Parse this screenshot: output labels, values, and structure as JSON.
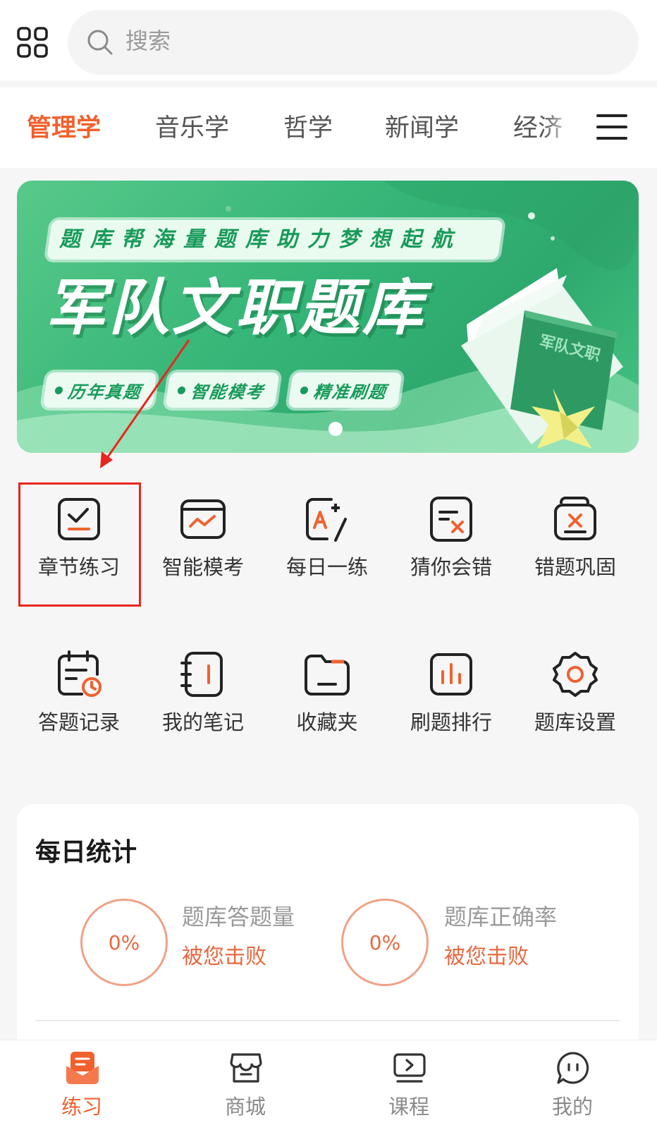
{
  "search": {
    "placeholder": "搜索"
  },
  "tabs": [
    {
      "label": "管理学",
      "active": true
    },
    {
      "label": "音乐学",
      "active": false
    },
    {
      "label": "哲学",
      "active": false
    },
    {
      "label": "新闻学",
      "active": false
    },
    {
      "label": "经济",
      "active": false
    }
  ],
  "banner": {
    "slogan": "题库帮海量题库助力梦想起航",
    "title": "军队文职题库",
    "pills": [
      "历年真题",
      "智能模考",
      "精准刷题"
    ],
    "book_cover_text": "军队文职",
    "carousel": {
      "pages": 1,
      "current": 1
    }
  },
  "features": [
    {
      "label": "章节练习",
      "icon": "chapter-check-icon",
      "highlighted": true
    },
    {
      "label": "智能模考",
      "icon": "trend-chart-icon",
      "highlighted": false
    },
    {
      "label": "每日一练",
      "icon": "a-plus-pen-icon",
      "highlighted": false
    },
    {
      "label": "猜你会错",
      "icon": "doc-x-icon",
      "highlighted": false
    },
    {
      "label": "错题巩固",
      "icon": "stacked-x-icon",
      "highlighted": false
    },
    {
      "label": "答题记录",
      "icon": "calendar-clock-icon",
      "highlighted": false
    },
    {
      "label": "我的笔记",
      "icon": "notebook-icon",
      "highlighted": false
    },
    {
      "label": "收藏夹",
      "icon": "folder-icon",
      "highlighted": false
    },
    {
      "label": "刷题排行",
      "icon": "bar-rank-icon",
      "highlighted": false
    },
    {
      "label": "题库设置",
      "icon": "settings-gear-icon",
      "highlighted": false
    }
  ],
  "stats": {
    "title": "每日统计",
    "items": [
      {
        "value": "0%",
        "label": "题库答题量",
        "sub": "被您击败"
      },
      {
        "value": "0%",
        "label": "题库正确率",
        "sub": "被您击败"
      }
    ]
  },
  "nav": [
    {
      "label": "练习",
      "icon": "practice-icon",
      "active": true
    },
    {
      "label": "商城",
      "icon": "shop-icon",
      "active": false
    },
    {
      "label": "课程",
      "icon": "course-play-icon",
      "active": false
    },
    {
      "label": "我的",
      "icon": "chat-profile-icon",
      "active": false
    }
  ],
  "colors": {
    "accent": "#f0612e",
    "stat_ring": "#f1a185",
    "banner_green": "#34b577",
    "highlight_box": "#e8261f"
  }
}
